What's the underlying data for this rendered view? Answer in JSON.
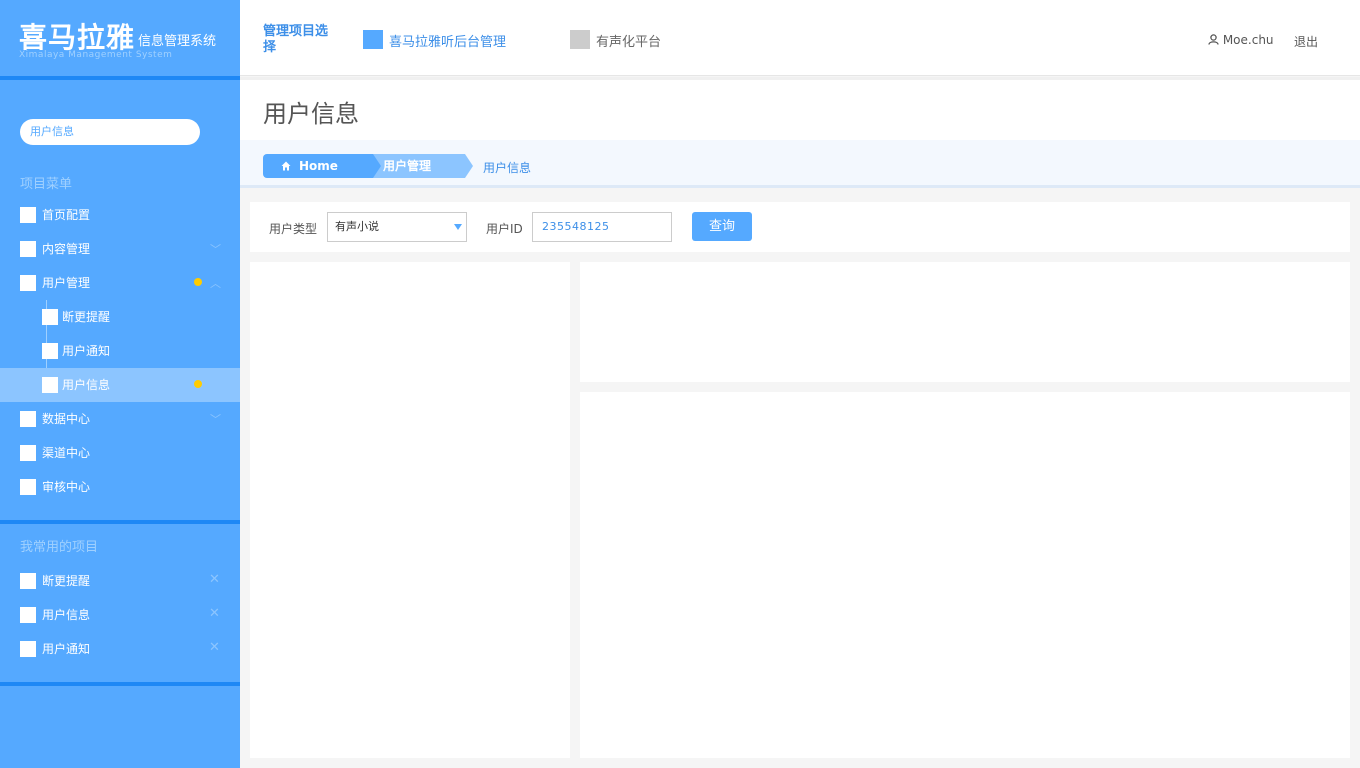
{
  "logo": {
    "main": "喜马拉雅",
    "sub": "信息管理系统",
    "en": "Ximalaya Management System"
  },
  "sidebar": {
    "search_value": "用户信息",
    "section1_title": "项目菜单",
    "items": [
      {
        "label": "首页配置"
      },
      {
        "label": "内容管理",
        "chevron": "﹀"
      },
      {
        "label": "用户管理",
        "chevron": "︿"
      },
      {
        "label": "断更提醒"
      },
      {
        "label": "用户通知"
      },
      {
        "label": "用户信息"
      },
      {
        "label": "数据中心",
        "chevron": "﹀"
      },
      {
        "label": "渠道中心"
      },
      {
        "label": "审核中心"
      }
    ],
    "section2_title": "我常用的项目",
    "favorites": [
      {
        "label": "断更提醒",
        "remove": "✕"
      },
      {
        "label": "用户信息",
        "remove": "✕"
      },
      {
        "label": "用户通知",
        "remove": "✕"
      }
    ]
  },
  "header": {
    "project_select": "管理项目选择",
    "projects": [
      {
        "label": "喜马拉雅听后台管理",
        "color": "#55a9ff",
        "text_color": "#3d8fe8"
      },
      {
        "label": "有声化平台",
        "color": "#cccccc",
        "text_color": "#666666"
      }
    ],
    "user": "Moe.chu",
    "logout": "退出"
  },
  "page_title": "用户信息",
  "breadcrumb": {
    "home": "Home",
    "level2": "用户管理",
    "level3": "用户信息"
  },
  "filter": {
    "type_label": "用户类型",
    "type_value": "有声小说",
    "id_label": "用户ID",
    "id_value": "235548125",
    "query_button": "查询"
  },
  "colors": {
    "primary": "#55a9ff",
    "accent_dot": "#ffcc00",
    "dark_line": "#1e88f5"
  }
}
